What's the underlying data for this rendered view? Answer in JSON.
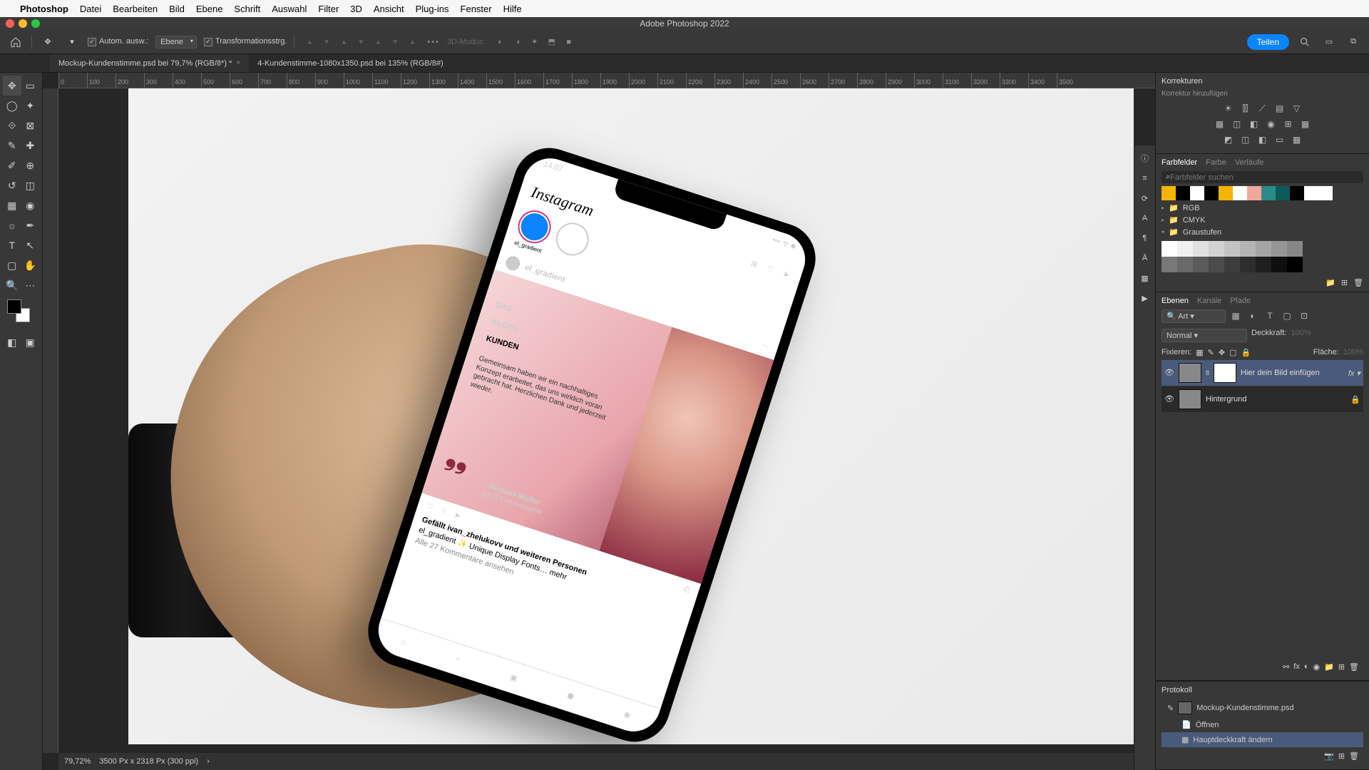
{
  "menubar": {
    "app": "Photoshop",
    "items": [
      "Datei",
      "Bearbeiten",
      "Bild",
      "Ebene",
      "Schrift",
      "Auswahl",
      "Filter",
      "3D",
      "Ansicht",
      "Plug-ins",
      "Fenster",
      "Hilfe"
    ]
  },
  "window_title": "Adobe Photoshop 2022",
  "options": {
    "auto_select": "Autom. ausw.:",
    "layer_dd": "Ebene",
    "transform": "Transformationsstrg.",
    "mode_3d": "3D-Modus:",
    "share": "Teilen"
  },
  "tabs": [
    {
      "label": "Mockup-Kundenstimme.psd bei 79,7% (RGB/8*) *",
      "active": true
    },
    {
      "label": "4-Kundenstimme-1080x1350.psd bei 135% (RGB/8#)",
      "active": false
    }
  ],
  "ruler_ticks": [
    "0",
    "100",
    "200",
    "300",
    "400",
    "500",
    "600",
    "700",
    "800",
    "900",
    "1000",
    "1100",
    "1200",
    "1300",
    "1400",
    "1500",
    "1600",
    "1700",
    "1800",
    "1900",
    "2000",
    "2100",
    "2200",
    "2300",
    "2400",
    "2500",
    "2600",
    "2700",
    "2800",
    "2900",
    "3000",
    "3100",
    "3200",
    "3300",
    "3400",
    "3500"
  ],
  "status": {
    "zoom": "79,72%",
    "dims": "3500 Px x 2318 Px (300 ppi)"
  },
  "adjustments": {
    "title": "Korrekturen",
    "add": "Korrektur hinzufügen"
  },
  "swatches": {
    "tabs": [
      "Farbfelder",
      "Farbe",
      "Verläufe"
    ],
    "search_ph": "Farbfelder suchen",
    "folders": [
      "RGB",
      "CMYK",
      "Graustufen"
    ],
    "colors": [
      "#f4b400",
      "#000",
      "#fff",
      "#000",
      "#f4b400",
      "#fff",
      "#f2a69c",
      "#2a8a8a",
      "#0b5a5a",
      "#000",
      "#fff",
      "#fff"
    ]
  },
  "layers": {
    "tabs": [
      "Ebenen",
      "Kanäle",
      "Pfade"
    ],
    "search": "Art",
    "blend": "Normal",
    "opacity_label": "Deckkraft:",
    "opacity": "100%",
    "lock_label": "Fixieren:",
    "fill_label": "Fläche:",
    "fill": "100%",
    "items": [
      {
        "name": "Hier dein Bild einfügen",
        "sel": true,
        "fx": true,
        "mask": true
      },
      {
        "name": "Hintergrund",
        "sel": false,
        "lock": true
      }
    ]
  },
  "history": {
    "title": "Protokoll",
    "doc": "Mockup-Kundenstimme.psd",
    "items": [
      "Öffnen",
      "Hauptdeckkraft ändern"
    ]
  },
  "mockup": {
    "time": "14:07",
    "ig": "Instagram",
    "story_name": "el_gradient",
    "headline_1": "DAS",
    "headline_2": "SAGEN",
    "headline_3": "KUNDEN",
    "body": "Gemeinsam haben wir ein nachhaltiges Konzept erarbeitet, das uns wirklich voran gebracht hat. Herzlichen Dank und jederzeit wieder.",
    "sig_name": "Michael Müller",
    "sig_title": "CEO Firmenname",
    "likes": "Gefällt ivan_zhelukovv und weiteren Personen",
    "caption": "el_gradient ✨ Unique Display Fonts… mehr",
    "comments": "Alle 27 Kommentare ansehen"
  }
}
